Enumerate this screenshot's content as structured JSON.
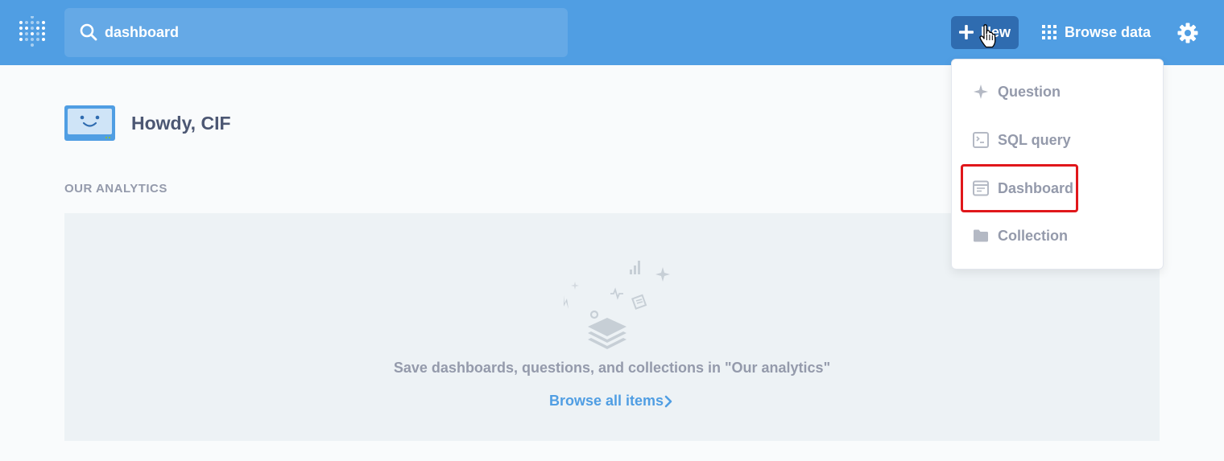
{
  "header": {
    "search_value": "dashboard",
    "new_label": "New",
    "browse_label": "Browse data",
    "accent_color": "#509ee3"
  },
  "home": {
    "greeting": "Howdy, CIF",
    "section_label": "OUR ANALYTICS",
    "empty_message": "Save dashboards, questions, and collections in \"Our analytics\"",
    "browse_all_label": "Browse all items"
  },
  "new_menu": {
    "items": [
      {
        "label": "Question",
        "icon": "sparkle-icon"
      },
      {
        "label": "SQL query",
        "icon": "terminal-icon"
      },
      {
        "label": "Dashboard",
        "icon": "dashboard-icon",
        "highlighted": true
      },
      {
        "label": "Collection",
        "icon": "folder-icon"
      }
    ],
    "highlight_color": "#e0171b"
  }
}
